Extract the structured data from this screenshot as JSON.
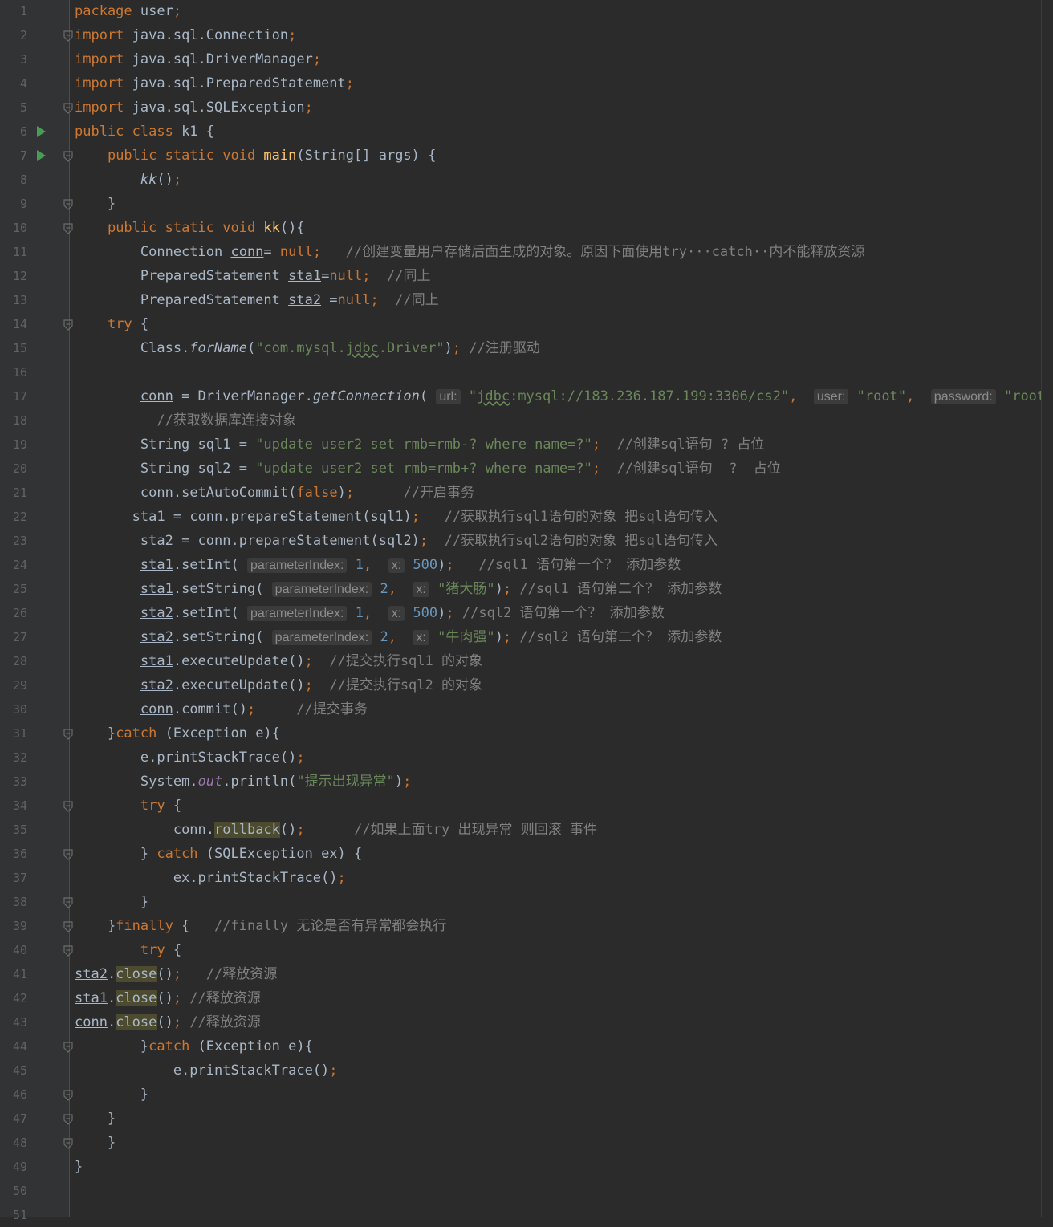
{
  "editor": {
    "lines": [
      {
        "n": "1",
        "t": [
          [
            "k",
            "package "
          ],
          [
            "",
            "user"
          ],
          [
            "k",
            ";"
          ]
        ]
      },
      {
        "n": "2",
        "t": [
          [
            "k",
            "import "
          ],
          [
            "",
            "java.sql.Connection"
          ],
          [
            "k",
            ";"
          ]
        ]
      },
      {
        "n": "3",
        "t": [
          [
            "k",
            "import "
          ],
          [
            "",
            "java.sql.DriverManager"
          ],
          [
            "k",
            ";"
          ]
        ]
      },
      {
        "n": "4",
        "t": [
          [
            "k",
            "import "
          ],
          [
            "",
            "java.sql.PreparedStatement"
          ],
          [
            "k",
            ";"
          ]
        ]
      },
      {
        "n": "5",
        "t": [
          [
            "k",
            "import "
          ],
          [
            "",
            "java.sql.SQLException"
          ],
          [
            "k",
            ";"
          ]
        ]
      },
      {
        "n": "6",
        "t": [
          [
            "k",
            "public class "
          ],
          [
            "",
            "k1 {"
          ]
        ]
      },
      {
        "n": "7",
        "t": [
          [
            "",
            "    "
          ],
          [
            "k",
            "public static void "
          ],
          [
            "fn",
            "main"
          ],
          [
            "",
            "(String[] args) {"
          ]
        ]
      },
      {
        "n": "8",
        "t": [
          [
            "",
            "        "
          ],
          [
            "it",
            "kk"
          ],
          [
            "",
            "()"
          ],
          [
            "k",
            ";"
          ]
        ]
      },
      {
        "n": "9",
        "t": [
          [
            "",
            "    }"
          ]
        ]
      },
      {
        "n": "10",
        "t": [
          [
            "",
            "    "
          ],
          [
            "k",
            "public static void "
          ],
          [
            "fn",
            "kk"
          ],
          [
            "",
            "(){"
          ]
        ]
      },
      {
        "n": "11",
        "t": [
          [
            "",
            "        Connection "
          ],
          [
            "u",
            "conn"
          ],
          [
            "",
            "= "
          ],
          [
            "k",
            "null;"
          ],
          [
            "",
            "   "
          ],
          [
            "c",
            "//创建变量用户存储后面生成的对象。原因下面使用try···catch··内不能释放资源"
          ]
        ]
      },
      {
        "n": "12",
        "t": [
          [
            "",
            "        PreparedStatement "
          ],
          [
            "u",
            "sta1"
          ],
          [
            "",
            "="
          ],
          [
            "k",
            "null;"
          ],
          [
            "",
            "  "
          ],
          [
            "c",
            "//同上"
          ]
        ]
      },
      {
        "n": "13",
        "t": [
          [
            "",
            "        PreparedStatement "
          ],
          [
            "u",
            "sta2"
          ],
          [
            "",
            " ="
          ],
          [
            "k",
            "null;"
          ],
          [
            "",
            "  "
          ],
          [
            "c",
            "//同上"
          ]
        ]
      },
      {
        "n": "14",
        "t": [
          [
            "",
            "    "
          ],
          [
            "k",
            "try "
          ],
          [
            "",
            "{"
          ]
        ]
      },
      {
        "n": "15",
        "t": [
          [
            "",
            "        Class."
          ],
          [
            "it",
            "forName"
          ],
          [
            "",
            "("
          ],
          [
            "s",
            "\"com.mysql."
          ],
          [
            "sw",
            "jdbc"
          ],
          [
            "s",
            ".Driver\""
          ],
          [
            "",
            ")"
          ],
          [
            "k",
            "; "
          ],
          [
            "c",
            "//注册驱动"
          ]
        ]
      },
      {
        "n": "16",
        "t": []
      },
      {
        "n": "17",
        "t": [
          [
            "",
            "        "
          ],
          [
            "u",
            "conn"
          ],
          [
            "",
            " = DriverManager."
          ],
          [
            "it",
            "getConnection"
          ],
          [
            "",
            "( "
          ],
          [
            "h",
            "url:"
          ],
          [
            "",
            " "
          ],
          [
            "s",
            "\""
          ],
          [
            "sw",
            "jdbc"
          ],
          [
            "s",
            ":mysql://183.236.187.199:3306/cs2\""
          ],
          [
            "k",
            ", "
          ],
          [
            "",
            " "
          ],
          [
            "h",
            "user:"
          ],
          [
            "",
            " "
          ],
          [
            "s",
            "\"root\""
          ],
          [
            "k",
            ", "
          ],
          [
            "",
            " "
          ],
          [
            "h",
            "password:"
          ],
          [
            "",
            " "
          ],
          [
            "s",
            "\"root\""
          ],
          [
            "",
            ")"
          ],
          [
            "k",
            ";"
          ]
        ]
      },
      {
        "n": "18",
        "t": [
          [
            "",
            "          "
          ],
          [
            "c",
            "//获取数据库连接对象"
          ]
        ]
      },
      {
        "n": "19",
        "t": [
          [
            "",
            "        String sql1 = "
          ],
          [
            "s",
            "\"update user2 set rmb=rmb-? where name=?\""
          ],
          [
            "k",
            ";"
          ],
          [
            "",
            "  "
          ],
          [
            "c",
            "//创建sql语句 ? 占位"
          ]
        ]
      },
      {
        "n": "20",
        "t": [
          [
            "",
            "        String sql2 = "
          ],
          [
            "s",
            "\"update user2 set rmb=rmb+? where name=?\""
          ],
          [
            "k",
            ";"
          ],
          [
            "",
            "  "
          ],
          [
            "c",
            "//创建sql语句  ?  占位"
          ]
        ]
      },
      {
        "n": "21",
        "t": [
          [
            "",
            "        "
          ],
          [
            "u",
            "conn"
          ],
          [
            "",
            ".setAutoCommit("
          ],
          [
            "k",
            "false"
          ],
          [
            "",
            ")"
          ],
          [
            "k",
            ";"
          ],
          [
            "",
            "      "
          ],
          [
            "c",
            "//开启事务"
          ]
        ]
      },
      {
        "n": "22",
        "t": [
          [
            "",
            "       "
          ],
          [
            "u",
            "sta1"
          ],
          [
            "",
            " = "
          ],
          [
            "u",
            "conn"
          ],
          [
            "",
            ".prepareStatement(sql1)"
          ],
          [
            "k",
            ";"
          ],
          [
            "",
            "   "
          ],
          [
            "c",
            "//获取执行sql1语句的对象 把sql语句传入"
          ]
        ]
      },
      {
        "n": "23",
        "t": [
          [
            "",
            "        "
          ],
          [
            "u",
            "sta2"
          ],
          [
            "",
            " = "
          ],
          [
            "u",
            "conn"
          ],
          [
            "",
            ".prepareStatement(sql2)"
          ],
          [
            "k",
            ";"
          ],
          [
            "",
            "  "
          ],
          [
            "c",
            "//获取执行sql2语句的对象 把sql语句传入"
          ]
        ]
      },
      {
        "n": "24",
        "t": [
          [
            "",
            "        "
          ],
          [
            "u",
            "sta1"
          ],
          [
            "",
            ".setInt( "
          ],
          [
            "h",
            "parameterIndex:"
          ],
          [
            "",
            " "
          ],
          [
            "n",
            "1"
          ],
          [
            "k",
            ", "
          ],
          [
            "",
            " "
          ],
          [
            "h",
            "x:"
          ],
          [
            "",
            " "
          ],
          [
            "n",
            "500"
          ],
          [
            "",
            ")"
          ],
          [
            "k",
            ";"
          ],
          [
            "",
            "   "
          ],
          [
            "c",
            "//sql1 语句第一个？ 添加参数"
          ]
        ]
      },
      {
        "n": "25",
        "t": [
          [
            "",
            "        "
          ],
          [
            "u",
            "sta1"
          ],
          [
            "",
            ".setString( "
          ],
          [
            "h",
            "parameterIndex:"
          ],
          [
            "",
            " "
          ],
          [
            "n",
            "2"
          ],
          [
            "k",
            ", "
          ],
          [
            "",
            " "
          ],
          [
            "h",
            "x:"
          ],
          [
            "",
            " "
          ],
          [
            "s",
            "\"猪大肠\""
          ],
          [
            "",
            ")"
          ],
          [
            "k",
            "; "
          ],
          [
            "c",
            "//sql1 语句第二个？ 添加参数"
          ]
        ]
      },
      {
        "n": "26",
        "t": [
          [
            "",
            "        "
          ],
          [
            "u",
            "sta2"
          ],
          [
            "",
            ".setInt( "
          ],
          [
            "h",
            "parameterIndex:"
          ],
          [
            "",
            " "
          ],
          [
            "n",
            "1"
          ],
          [
            "k",
            ", "
          ],
          [
            "",
            " "
          ],
          [
            "h",
            "x:"
          ],
          [
            "",
            " "
          ],
          [
            "n",
            "500"
          ],
          [
            "",
            ")"
          ],
          [
            "k",
            "; "
          ],
          [
            "c",
            "//sql2 语句第一个？ 添加参数"
          ]
        ]
      },
      {
        "n": "27",
        "t": [
          [
            "",
            "        "
          ],
          [
            "u",
            "sta2"
          ],
          [
            "",
            ".setString( "
          ],
          [
            "h",
            "parameterIndex:"
          ],
          [
            "",
            " "
          ],
          [
            "n",
            "2"
          ],
          [
            "k",
            ", "
          ],
          [
            "",
            " "
          ],
          [
            "h",
            "x:"
          ],
          [
            "",
            " "
          ],
          [
            "s",
            "\"牛肉强\""
          ],
          [
            "",
            ")"
          ],
          [
            "k",
            "; "
          ],
          [
            "c",
            "//sql2 语句第二个？ 添加参数"
          ]
        ]
      },
      {
        "n": "28",
        "t": [
          [
            "",
            "        "
          ],
          [
            "u",
            "sta1"
          ],
          [
            "",
            ".executeUpdate()"
          ],
          [
            "k",
            ";"
          ],
          [
            "",
            "  "
          ],
          [
            "c",
            "//提交执行sql1 的对象"
          ]
        ]
      },
      {
        "n": "29",
        "t": [
          [
            "",
            "        "
          ],
          [
            "u",
            "sta2"
          ],
          [
            "",
            ".executeUpdate()"
          ],
          [
            "k",
            ";"
          ],
          [
            "",
            "  "
          ],
          [
            "c",
            "//提交执行sql2 的对象"
          ]
        ]
      },
      {
        "n": "30",
        "t": [
          [
            "",
            "        "
          ],
          [
            "u",
            "conn"
          ],
          [
            "",
            ".commit()"
          ],
          [
            "k",
            ";"
          ],
          [
            "",
            "     "
          ],
          [
            "c",
            "//提交事务"
          ]
        ]
      },
      {
        "n": "31",
        "t": [
          [
            "",
            "    }"
          ],
          [
            "k",
            "catch "
          ],
          [
            "",
            "(Exception e){"
          ]
        ]
      },
      {
        "n": "32",
        "t": [
          [
            "",
            "        e.printStackTrace()"
          ],
          [
            "k",
            ";"
          ]
        ]
      },
      {
        "n": "33",
        "t": [
          [
            "",
            "        System."
          ],
          [
            "st",
            "out"
          ],
          [
            "",
            ".println("
          ],
          [
            "s",
            "\"提示出现异常\""
          ],
          [
            "",
            ")"
          ],
          [
            "k",
            ";"
          ]
        ]
      },
      {
        "n": "34",
        "t": [
          [
            "",
            "        "
          ],
          [
            "k",
            "try "
          ],
          [
            "",
            "{"
          ]
        ]
      },
      {
        "n": "35",
        "t": [
          [
            "",
            "            "
          ],
          [
            "u",
            "conn"
          ],
          [
            "",
            "."
          ],
          [
            "hl",
            "rollback"
          ],
          [
            "",
            "()"
          ],
          [
            "k",
            ";"
          ],
          [
            "",
            "      "
          ],
          [
            "c",
            "//如果上面try 出现异常 则回滚 事件"
          ]
        ]
      },
      {
        "n": "36",
        "t": [
          [
            "",
            "        } "
          ],
          [
            "k",
            "catch "
          ],
          [
            "",
            "(SQLException ex) {"
          ]
        ]
      },
      {
        "n": "37",
        "t": [
          [
            "",
            "            ex.printStackTrace()"
          ],
          [
            "k",
            ";"
          ]
        ]
      },
      {
        "n": "38",
        "t": [
          [
            "",
            "        }"
          ]
        ]
      },
      {
        "n": "39",
        "t": [
          [
            "",
            "    }"
          ],
          [
            "k",
            "finally "
          ],
          [
            "",
            "{   "
          ],
          [
            "c",
            "//finally 无论是否有异常都会执行"
          ]
        ]
      },
      {
        "n": "40",
        "t": [
          [
            "",
            "        "
          ],
          [
            "k",
            "try "
          ],
          [
            "",
            "{"
          ]
        ]
      },
      {
        "n": "41",
        "t": [
          [
            "u",
            "sta2"
          ],
          [
            "",
            "."
          ],
          [
            "hl",
            "close"
          ],
          [
            "",
            "()"
          ],
          [
            "k",
            ";"
          ],
          [
            "",
            "   "
          ],
          [
            "c",
            "//释放资源"
          ]
        ]
      },
      {
        "n": "42",
        "t": [
          [
            "u",
            "sta1"
          ],
          [
            "",
            "."
          ],
          [
            "hl",
            "close"
          ],
          [
            "",
            "()"
          ],
          [
            "k",
            "; "
          ],
          [
            "c",
            "//释放资源"
          ]
        ]
      },
      {
        "n": "43",
        "t": [
          [
            "u",
            "conn"
          ],
          [
            "",
            "."
          ],
          [
            "hl",
            "close"
          ],
          [
            "",
            "()"
          ],
          [
            "k",
            "; "
          ],
          [
            "c",
            "//释放资源"
          ]
        ]
      },
      {
        "n": "44",
        "t": [
          [
            "",
            "        }"
          ],
          [
            "k",
            "catch "
          ],
          [
            "",
            "(Exception e){"
          ]
        ]
      },
      {
        "n": "45",
        "t": [
          [
            "",
            "            e.printStackTrace()"
          ],
          [
            "k",
            ";"
          ]
        ]
      },
      {
        "n": "46",
        "t": [
          [
            "",
            "        }"
          ]
        ]
      },
      {
        "n": "47",
        "t": [
          [
            "",
            "    }"
          ]
        ]
      },
      {
        "n": "48",
        "t": [
          [
            "",
            "    }"
          ]
        ]
      },
      {
        "n": "49",
        "t": [
          [
            "",
            "}"
          ]
        ]
      },
      {
        "n": "50",
        "t": []
      },
      {
        "n": "51",
        "t": []
      }
    ],
    "gutter": {
      "run_lines": [
        "6",
        "7"
      ],
      "fold_lines": [
        "2",
        "5",
        "7",
        "9",
        "10",
        "14",
        "31",
        "34",
        "36",
        "38",
        "39",
        "40",
        "44",
        "46",
        "47",
        "48"
      ]
    },
    "colors": {
      "background": "#2b2b2b",
      "gutter": "#313335",
      "keyword": "#cc7832",
      "string": "#6a8759",
      "number": "#6897bb",
      "comment": "#808080",
      "method_decl": "#ffc66d",
      "static_field": "#9876aa",
      "run_icon": "#499c54"
    }
  }
}
